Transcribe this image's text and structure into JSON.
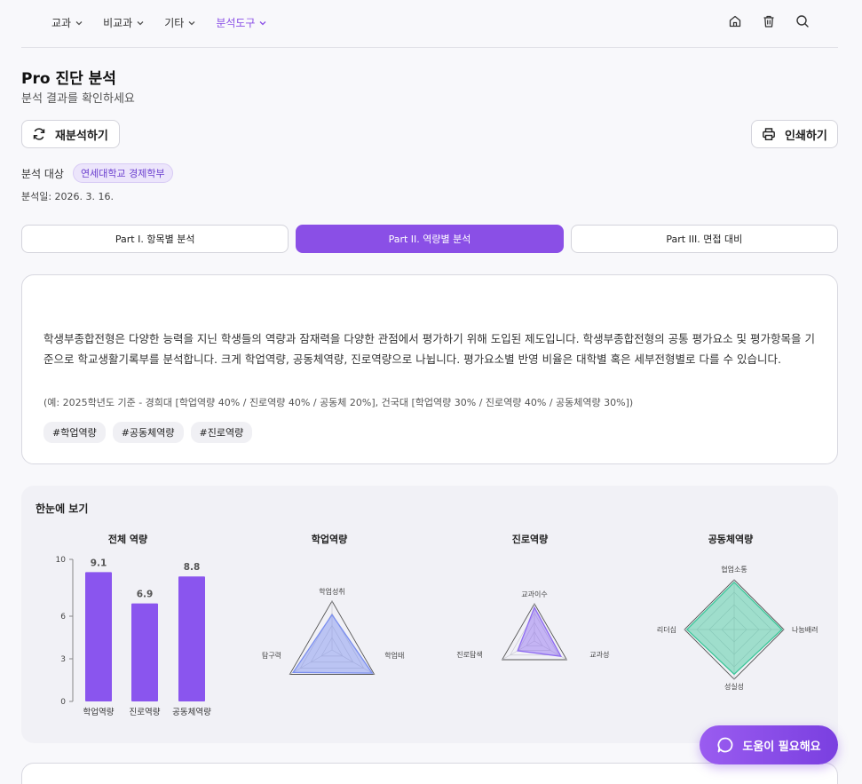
{
  "nav": {
    "menu": [
      {
        "label": "교과",
        "active": false
      },
      {
        "label": "비교과",
        "active": false
      },
      {
        "label": "기타",
        "active": false
      },
      {
        "label": "분석도구",
        "active": true
      }
    ],
    "icons": [
      "home-icon",
      "trash-icon",
      "search-icon"
    ]
  },
  "header": {
    "title": "Pro 진단 분석",
    "subtitle": "분석 결과를 확인하세요"
  },
  "actions": {
    "reanalyze": "재분석하기",
    "print": "인쇄하기"
  },
  "target": {
    "label": "분석 대상",
    "value": "연세대학교 경제학부",
    "date": "분석일: 2026. 3. 16."
  },
  "tabs": [
    {
      "label": "Part I. 항목별 분석",
      "active": false
    },
    {
      "label": "Part II. 역량별 분석",
      "active": true
    },
    {
      "label": "Part III. 면접 대비",
      "active": false
    }
  ],
  "info": {
    "text": "학생부종합전형은 다양한 능력을 지닌 학생들의 역량과 잠재력을 다양한 관점에서 평가하기 위해 도입된 제도입니다. 학생부종합전형의 공통 평가요소 및 평가항목을 기준으로 학교생활기록부를 분석합니다. 크게 학업역량, 공동체역량, 진로역량으로 나뉩니다. 평가요소별 반영 비율은 대학별 혹은 세부전형별로 다를 수 있습니다.",
    "example": "(예: 2025학년도 기준 - 경희대 [학업역량 40% / 진로역량 40% / 공동체 20%], 건국대 [학업역량 30% / 진로역량 40% / 공동체역량 30%])",
    "tags": [
      "#학업역량",
      "#공동체역량",
      "#진로역량"
    ]
  },
  "glance": {
    "title": "한눈에 보기"
  },
  "chart_data": [
    {
      "type": "bar",
      "title": "전체 역량",
      "categories": [
        "학업역량",
        "진로역량",
        "공동체역량"
      ],
      "values": [
        9.1,
        6.9,
        8.8
      ],
      "yticks": [
        0,
        3,
        6,
        10
      ],
      "ylim": [
        0,
        10
      ],
      "color": "#8a55ee"
    },
    {
      "type": "radar",
      "title": "학업역량",
      "axes": [
        "학업성취",
        "학업태도",
        "탐구력"
      ],
      "values": [
        0.72,
        0.95,
        0.92
      ],
      "color": "#7b8ff0"
    },
    {
      "type": "radar",
      "title": "진로역량",
      "axes": [
        "교과이수",
        "교과성취",
        "진로탐색"
      ],
      "values": [
        0.9,
        0.82,
        0.52
      ],
      "color": "#8e6bf2"
    },
    {
      "type": "radar",
      "title": "공동체역량",
      "axes": [
        "협업소통",
        "나눔배려",
        "성실성",
        "리더십"
      ],
      "values": [
        0.95,
        0.96,
        0.9,
        0.95
      ],
      "color": "#3cc79a"
    }
  ],
  "help": {
    "label": "도움이 필요해요"
  }
}
